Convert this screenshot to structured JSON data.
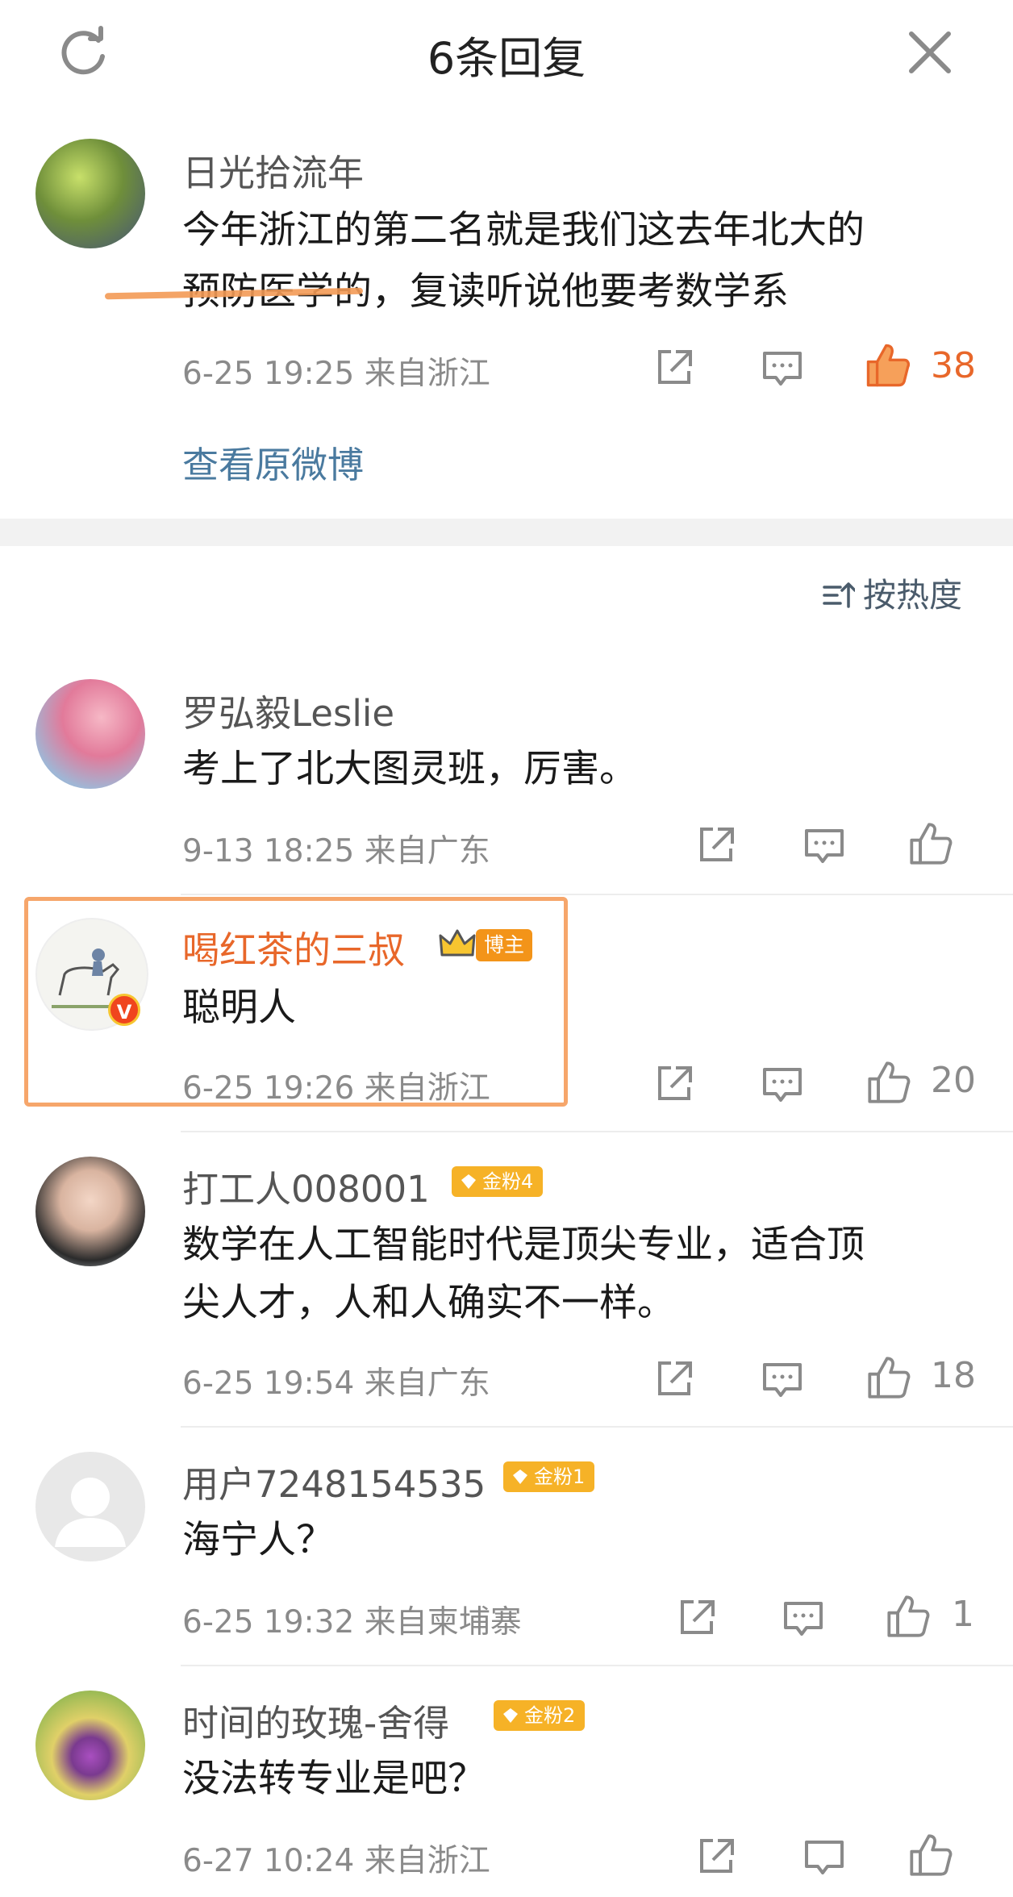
{
  "header": {
    "title": "6条回复"
  },
  "main_post": {
    "username": "日光拾流年",
    "text_line1": "今年浙江的第二名就是我们这去年北大的",
    "text_line2": "预防医学的，复读听说他要考数学系",
    "time": "6-25 19:25 来自浙江",
    "likes": "38",
    "view_original": "查看原微博"
  },
  "sort": {
    "label": "按热度"
  },
  "replies": [
    {
      "username": "罗弘毅Leslie",
      "text": "考上了北大图灵班，厉害。",
      "time": "9-13 18:25 来自广东",
      "likes": ""
    },
    {
      "username": "喝红茶的三叔",
      "badge": "博主",
      "text": "聪明人",
      "time": "6-25 19:26 来自浙江",
      "likes": "20"
    },
    {
      "username": "打工人008001",
      "badge": "金粉4",
      "text_line1": "数学在人工智能时代是顶尖专业，适合顶",
      "text_line2": "尖人才，人和人确实不一样。",
      "time": "6-25 19:54 来自广东",
      "likes": "18"
    },
    {
      "username": "用户7248154535",
      "badge": "金粉1",
      "text": "海宁人？",
      "time": "6-25 19:32 来自柬埔寨",
      "likes": "1"
    },
    {
      "username": "时间的玫瑰-舍得",
      "badge": "金粉2",
      "text": "没法转专业是吧？",
      "time": "6-27 10:24 来自浙江",
      "likes": ""
    }
  ],
  "colors": {
    "accent_orange": "#e8672a",
    "link_blue": "#4a7a9f",
    "badge_gold": "#f6b227"
  }
}
